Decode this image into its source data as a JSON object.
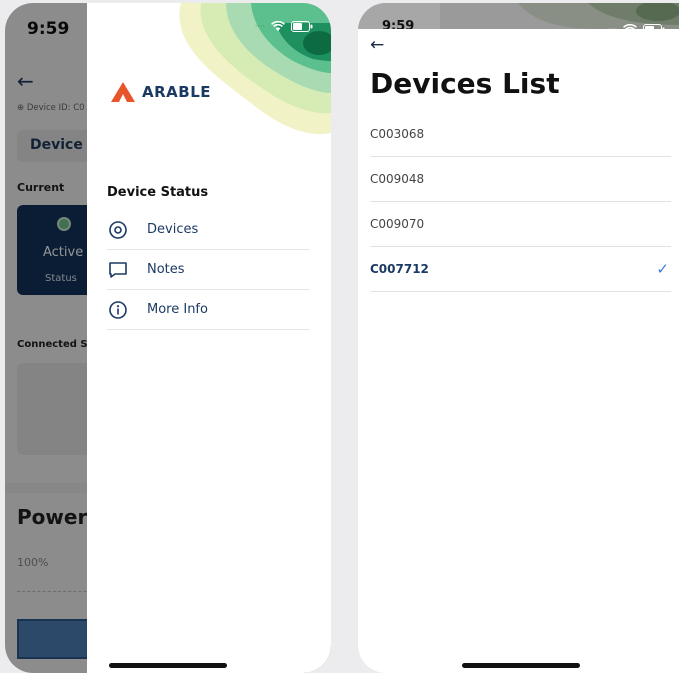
{
  "left_phone": {
    "background_app": {
      "status_time": "9:59",
      "device_id_label": "Device ID: C0",
      "device_status_tab": "Device S",
      "current_heading": "Current",
      "active_label": "Active",
      "status_label": "Status",
      "connected_heading": "Connected S",
      "power_heading": "Power",
      "power_percent": "100%"
    },
    "drawer": {
      "brand": "ARABLE",
      "section_title": "Device Status",
      "menu": [
        {
          "label": "Devices",
          "icon": "radio-target-icon"
        },
        {
          "label": "Notes",
          "icon": "chat-bubble-icon"
        },
        {
          "label": "More Info",
          "icon": "info-icon"
        }
      ]
    }
  },
  "right_phone": {
    "status_time": "9:59",
    "title": "Devices List",
    "devices": [
      {
        "id": "C003068",
        "selected": false
      },
      {
        "id": "C009048",
        "selected": false
      },
      {
        "id": "C009070",
        "selected": false
      },
      {
        "id": "C007712",
        "selected": true
      }
    ]
  },
  "colors": {
    "brand_orange": "#e9552a",
    "navy": "#1b3a63",
    "check_blue": "#3b7fd6",
    "active_card": "#14325a"
  }
}
